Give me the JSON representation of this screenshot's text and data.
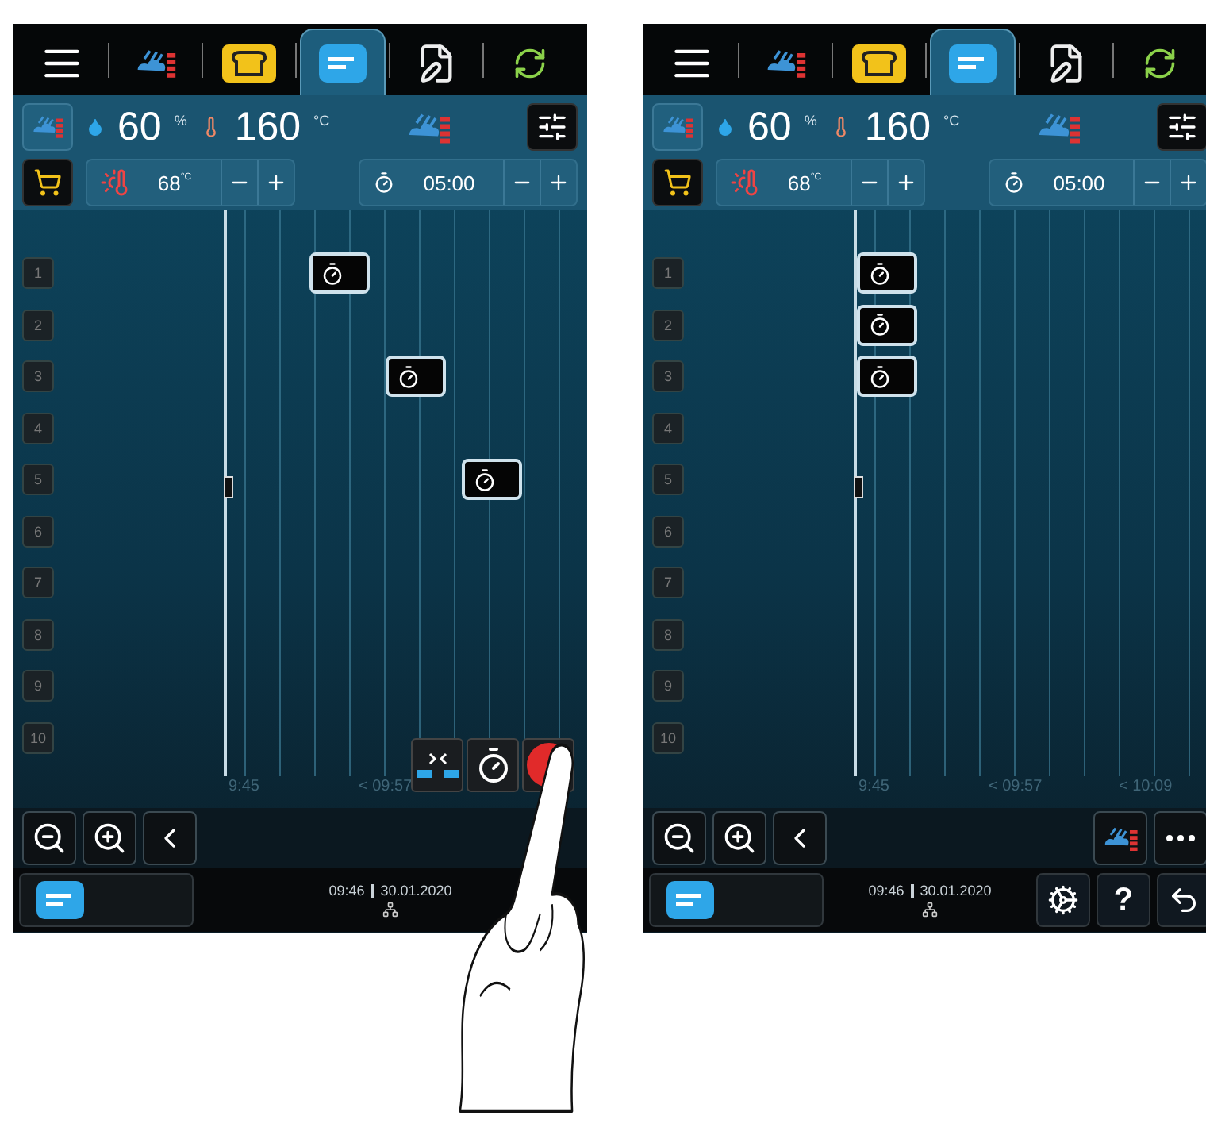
{
  "screens": [
    {
      "tabs": [
        {
          "kind": "menu",
          "selected": false
        },
        {
          "kind": "steam",
          "selected": false
        },
        {
          "kind": "bread",
          "selected": false
        },
        {
          "kind": "planner",
          "selected": true
        },
        {
          "kind": "edit",
          "selected": false
        },
        {
          "kind": "refresh",
          "selected": false
        }
      ],
      "climate": {
        "humidity": "60",
        "humidity_unit": "%",
        "temperature": "160",
        "temperature_unit": "°C"
      },
      "core_temp": {
        "value": "68",
        "unit": "°C"
      },
      "timer": {
        "value": "05:00"
      },
      "kind": "staggered",
      "racks": [
        {
          "label": "1",
          "timer": true
        },
        {
          "label": "2",
          "timer": false
        },
        {
          "label": "3",
          "timer": true
        },
        {
          "label": "4",
          "timer": false
        },
        {
          "label": "5",
          "timer": true
        },
        {
          "label": "6",
          "timer": false
        },
        {
          "label": "7",
          "timer": false
        },
        {
          "label": "8",
          "timer": false
        },
        {
          "label": "9",
          "timer": false
        },
        {
          "label": "10",
          "timer": false
        }
      ],
      "axis_labels": [
        "9:45",
        "< 09:57"
      ],
      "floating_actions": [
        {
          "kind": "merge"
        },
        {
          "kind": "timer"
        },
        {
          "kind": "record"
        }
      ],
      "status": {
        "time": "09:46",
        "date": "30.01.2020"
      },
      "overlay": {
        "kind": "hand"
      }
    },
    {
      "tabs": [
        {
          "kind": "menu",
          "selected": false
        },
        {
          "kind": "steam",
          "selected": false
        },
        {
          "kind": "bread",
          "selected": false
        },
        {
          "kind": "planner",
          "selected": true
        },
        {
          "kind": "edit",
          "selected": false
        },
        {
          "kind": "refresh",
          "selected": false
        }
      ],
      "climate": {
        "humidity": "60",
        "humidity_unit": "%",
        "temperature": "160",
        "temperature_unit": "°C"
      },
      "core_temp": {
        "value": "68",
        "unit": "°C"
      },
      "timer": {
        "value": "05:00"
      },
      "kind": "aligned",
      "racks": [
        {
          "label": "1",
          "timer": true
        },
        {
          "label": "2",
          "timer": true
        },
        {
          "label": "3",
          "timer": true
        },
        {
          "label": "4",
          "timer": false
        },
        {
          "label": "5",
          "timer": false
        },
        {
          "label": "6",
          "timer": false
        },
        {
          "label": "7",
          "timer": false
        },
        {
          "label": "8",
          "timer": false
        },
        {
          "label": "9",
          "timer": false
        },
        {
          "label": "10",
          "timer": false
        }
      ],
      "axis_labels": [
        "9:45",
        "< 09:57",
        "< 10:09"
      ],
      "toolbar_right": [
        {
          "kind": "steam"
        },
        {
          "kind": "more"
        }
      ],
      "status": {
        "time": "09:46",
        "date": "30.01.2020"
      },
      "status_buttons": [
        {
          "kind": "settings"
        },
        {
          "kind": "help",
          "label": "?"
        },
        {
          "kind": "back"
        }
      ]
    }
  ]
}
